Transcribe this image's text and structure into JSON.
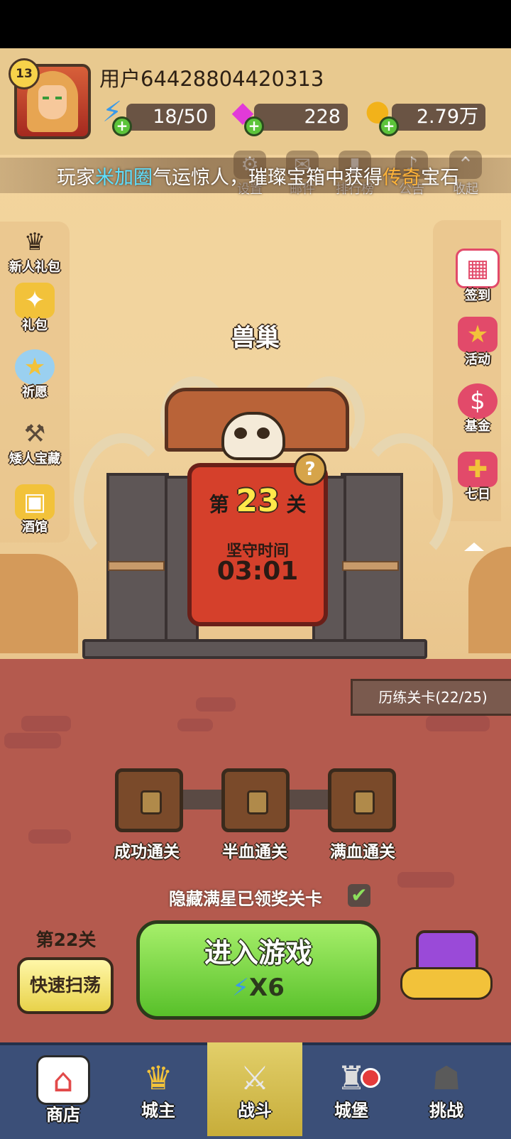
{
  "player": {
    "level": "13",
    "username": "用户64428804420313"
  },
  "resources": {
    "energy": "18/50",
    "gems": "228",
    "gold": "2.79万"
  },
  "announcement": {
    "prefix": "玩家",
    "player_name": "米加圈",
    "middle": "气运惊人，璀璨宝箱中获得",
    "rarity": "传奇",
    "suffix": "宝石"
  },
  "top_menu": [
    {
      "label": "设置",
      "icon": "gear-icon"
    },
    {
      "label": "邮件",
      "icon": "mail-icon"
    },
    {
      "label": "排行榜",
      "icon": "ranking-icon"
    },
    {
      "label": "公告",
      "icon": "bell-icon"
    },
    {
      "label": "收起",
      "icon": "collapse-icon"
    }
  ],
  "left_menu": [
    {
      "label": "新人礼包",
      "icon": "newbie-pack-icon"
    },
    {
      "label": "礼包",
      "icon": "gift-icon"
    },
    {
      "label": "祈愿",
      "icon": "wish-icon"
    },
    {
      "label": "矮人宝藏",
      "icon": "dwarf-treasure-icon"
    },
    {
      "label": "酒馆",
      "icon": "tavern-icon"
    }
  ],
  "right_menu": [
    {
      "label": "签到",
      "icon": "calendar-icon"
    },
    {
      "label": "活动",
      "icon": "event-icon"
    },
    {
      "label": "基金",
      "icon": "fund-icon"
    },
    {
      "label": "七日",
      "icon": "seven-day-icon"
    }
  ],
  "stage": {
    "location": "兽巢",
    "prefix": "第",
    "number": "23",
    "suffix": "关",
    "hold_label": "坚守时间",
    "hold_time": "03:01"
  },
  "trial_progress": "历练关卡(22/25)",
  "chests": [
    {
      "label": "成功通关"
    },
    {
      "label": "半血通关"
    },
    {
      "label": "满血通关"
    }
  ],
  "hide_completed": {
    "label": "隐藏满星已领奖关卡",
    "checked": true
  },
  "actions": {
    "last_stage": "第22关",
    "sweep": "快速扫荡",
    "enter": "进入游戏",
    "cost": "X6"
  },
  "nav": [
    {
      "label": "商店",
      "icon": "shop-icon"
    },
    {
      "label": "城主",
      "icon": "crown-icon"
    },
    {
      "label": "战斗",
      "icon": "swords-icon",
      "active": true
    },
    {
      "label": "城堡",
      "icon": "castle-icon"
    },
    {
      "label": "挑战",
      "icon": "demon-icon"
    }
  ],
  "colors": {
    "accent_green": "#58c02a",
    "plaque_red": "#d5402b",
    "nav_bg": "#3b4f78"
  }
}
